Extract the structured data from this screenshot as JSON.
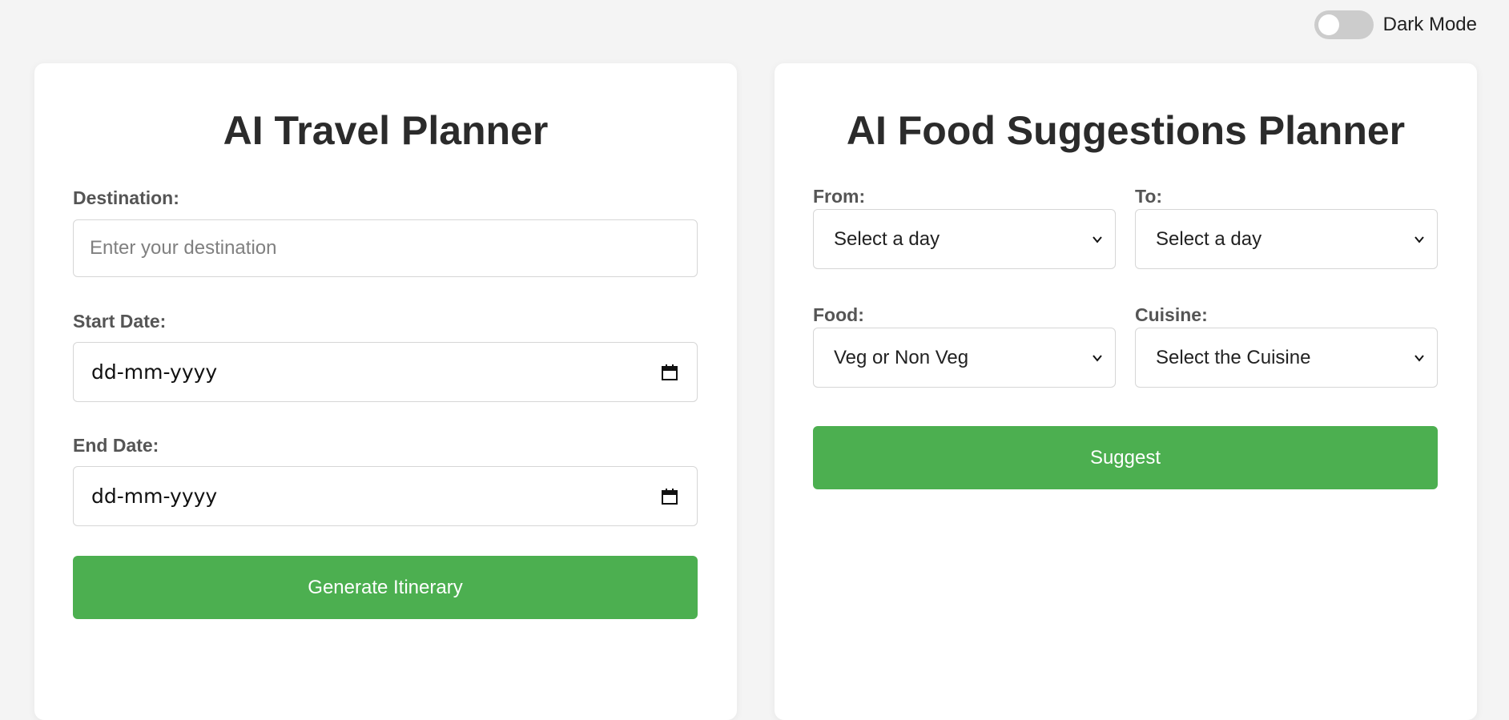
{
  "header": {
    "dark_mode_label": "Dark Mode",
    "dark_mode_on": false
  },
  "travel": {
    "title": "AI Travel Planner",
    "destination_label": "Destination:",
    "destination_placeholder": "Enter your destination",
    "start_label": "Start Date:",
    "start_value": "dd-mm-yyyy",
    "end_label": "End Date:",
    "end_value": "dd-mm-yyyy",
    "button_label": "Generate Itinerary"
  },
  "food": {
    "title": "AI Food Suggestions Planner",
    "from_label": "From:",
    "from_value": "Select a day",
    "to_label": "To:",
    "to_value": "Select a day",
    "food_label": "Food:",
    "food_value": "Veg or Non Veg",
    "cuisine_label": "Cuisine:",
    "cuisine_value": "Select the Cuisine",
    "button_label": "Suggest"
  },
  "colors": {
    "accent": "#4caf50",
    "background": "#f4f4f4",
    "card": "#ffffff"
  }
}
